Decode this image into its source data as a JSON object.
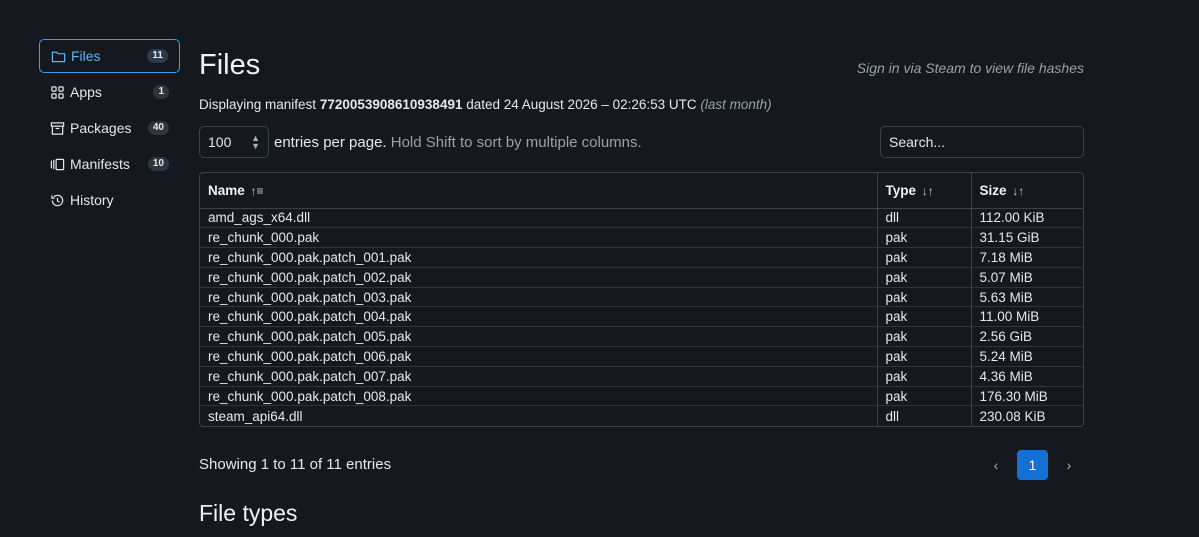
{
  "sidebar": {
    "items": [
      {
        "label": "Files",
        "badge": "11",
        "icon": "folder-icon",
        "active": true
      },
      {
        "label": "Apps",
        "badge": "1",
        "icon": "apps-grid-icon"
      },
      {
        "label": "Packages",
        "badge": "40",
        "icon": "archive-box-icon"
      },
      {
        "label": "Manifests",
        "badge": "10",
        "icon": "manifests-stack-icon"
      },
      {
        "label": "History",
        "badge": "",
        "icon": "history-icon"
      }
    ]
  },
  "header": {
    "title": "Files",
    "signin_text": "Sign in via Steam to view file hashes"
  },
  "manifest": {
    "prefix": "Displaying manifest ",
    "id": "7720053908610938491",
    "dated": " dated 24 August 2026 – 02:26:53 UTC ",
    "relative": "(last month)"
  },
  "controls": {
    "per_page_value": "100",
    "entries_label": "entries per page.",
    "hint": " Hold Shift to sort by multiple columns.",
    "search_placeholder": "Search..."
  },
  "table": {
    "columns": [
      {
        "label": "Name",
        "sort": "↑≡"
      },
      {
        "label": "Type",
        "sort": "↓↑"
      },
      {
        "label": "Size",
        "sort": "↓↑"
      }
    ],
    "rows": [
      [
        "amd_ags_x64.dll",
        "dll",
        "112.00 KiB"
      ],
      [
        "re_chunk_000.pak",
        "pak",
        "31.15 GiB"
      ],
      [
        "re_chunk_000.pak.patch_001.pak",
        "pak",
        "7.18 MiB"
      ],
      [
        "re_chunk_000.pak.patch_002.pak",
        "pak",
        "5.07 MiB"
      ],
      [
        "re_chunk_000.pak.patch_003.pak",
        "pak",
        "5.63 MiB"
      ],
      [
        "re_chunk_000.pak.patch_004.pak",
        "pak",
        "11.00 MiB"
      ],
      [
        "re_chunk_000.pak.patch_005.pak",
        "pak",
        "2.56 GiB"
      ],
      [
        "re_chunk_000.pak.patch_006.pak",
        "pak",
        "5.24 MiB"
      ],
      [
        "re_chunk_000.pak.patch_007.pak",
        "pak",
        "4.36 MiB"
      ],
      [
        "re_chunk_000.pak.patch_008.pak",
        "pak",
        "176.30 MiB"
      ],
      [
        "steam_api64.dll",
        "dll",
        "230.08 KiB"
      ]
    ]
  },
  "footer": {
    "showing": "Showing 1 to 11 of 11 entries",
    "prev": "‹",
    "current_page": "1",
    "next": "›"
  },
  "sections": {
    "file_types_title": "File types"
  },
  "colors": {
    "background": "#15181e",
    "accent": "#3aa0e6",
    "active_page": "#1570d4"
  }
}
